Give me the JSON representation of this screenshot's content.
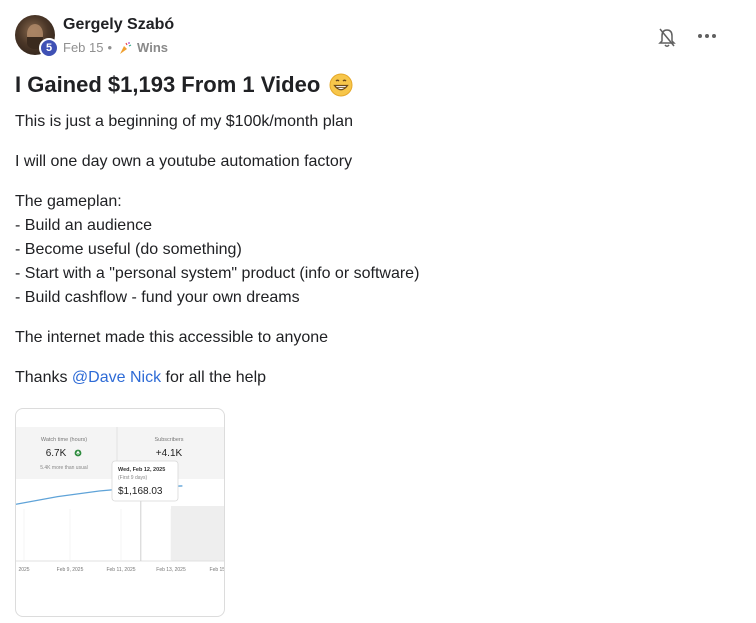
{
  "author": {
    "name": "Gergely Szabó",
    "level": "5",
    "date": "Feb 15",
    "separator": "•",
    "category": "Wins"
  },
  "post": {
    "title": "I Gained $1,193 From 1 Video",
    "title_emoji": "grinning-face-emoji",
    "paragraphs": [
      "This is just a beginning of my $100k/month plan",
      "I will one day own a youtube automation factory",
      "The gameplan:",
      "- Build an audience",
      "- Become useful (do something)",
      "- Start with a \"personal system\" product (info or software)",
      "- Build cashflow - fund your own dreams",
      "The internet made this accessible to anyone"
    ],
    "thanks_prefix": "Thanks ",
    "mention": "@Dave Nick",
    "thanks_suffix": " for all the help"
  },
  "icons": {
    "notify": "bell-icon",
    "menu": "more-options-icon",
    "category": "party-popper-icon"
  },
  "colors": {
    "accent": "#2e6bd6",
    "badge": "#3f51b5",
    "line": "#5fa3d8"
  },
  "chart_card": {
    "stats": [
      {
        "label": "Watch time (hours)",
        "value": "6.7K",
        "note": "5.4K more than usual"
      },
      {
        "label": "Subscribers",
        "value": "+4.1K"
      }
    ],
    "tooltip": {
      "date": "Wed, Feb 12, 2025",
      "subtitle": "(First 9 days)",
      "value": "$1,168.03"
    },
    "chart_data": {
      "type": "line",
      "x": [
        "Feb 7, 2025",
        "Feb 9, 2025",
        "Feb 11, 2025",
        "Feb 12, 2025",
        "Feb 13, 2025",
        "Feb 15, 2025"
      ],
      "tick_labels": [
        "2025",
        "Feb 9, 2025",
        "Feb 11, 2025",
        "Feb 13, 2025",
        "Feb 15,"
      ],
      "series": [
        {
          "values": [
            900,
            1020,
            1110,
            1168.03,
            1190,
            1193
          ]
        }
      ],
      "ylim": [
        0,
        1300
      ],
      "grid": true
    }
  }
}
